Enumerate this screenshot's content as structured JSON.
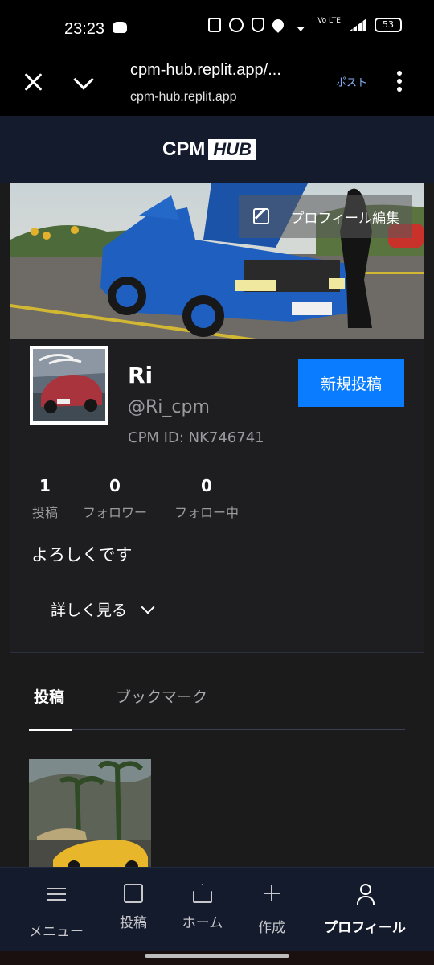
{
  "status_bar": {
    "time": "23:23",
    "battery": "53",
    "network": "Vo LTE"
  },
  "browser": {
    "page_title": "cpm-hub.replit.app/...",
    "domain": "cpm-hub.replit.app",
    "post_label": "ポスト"
  },
  "app": {
    "logo_cpm": "CPM",
    "logo_hub": "HUB"
  },
  "profile": {
    "edit_label": "プロフィール編集",
    "name": "Ri",
    "handle": "@Ri_cpm",
    "cpm_id": "CPM ID: NK746741",
    "new_post_label": "新規投稿",
    "stats": [
      {
        "value": "1",
        "label": "投稿"
      },
      {
        "value": "0",
        "label": "フォロワー"
      },
      {
        "value": "0",
        "label": "フォロー中"
      }
    ],
    "bio": "よろしくです",
    "show_more_label": "詳しく見る"
  },
  "tabs": [
    {
      "label": "投稿",
      "active": true
    },
    {
      "label": "ブックマーク",
      "active": false
    }
  ],
  "bottom_nav": [
    {
      "label": "メニュー",
      "icon": "menu-icon"
    },
    {
      "label": "投稿",
      "icon": "image-icon"
    },
    {
      "label": "ホーム",
      "icon": "home-icon"
    },
    {
      "label": "作成",
      "icon": "plus-icon"
    },
    {
      "label": "プロフィール",
      "icon": "person-icon",
      "active": true
    }
  ],
  "colors": {
    "accent": "#0a7cff",
    "header_bg": "#141b2d",
    "page_bg": "#1b1b1c"
  }
}
